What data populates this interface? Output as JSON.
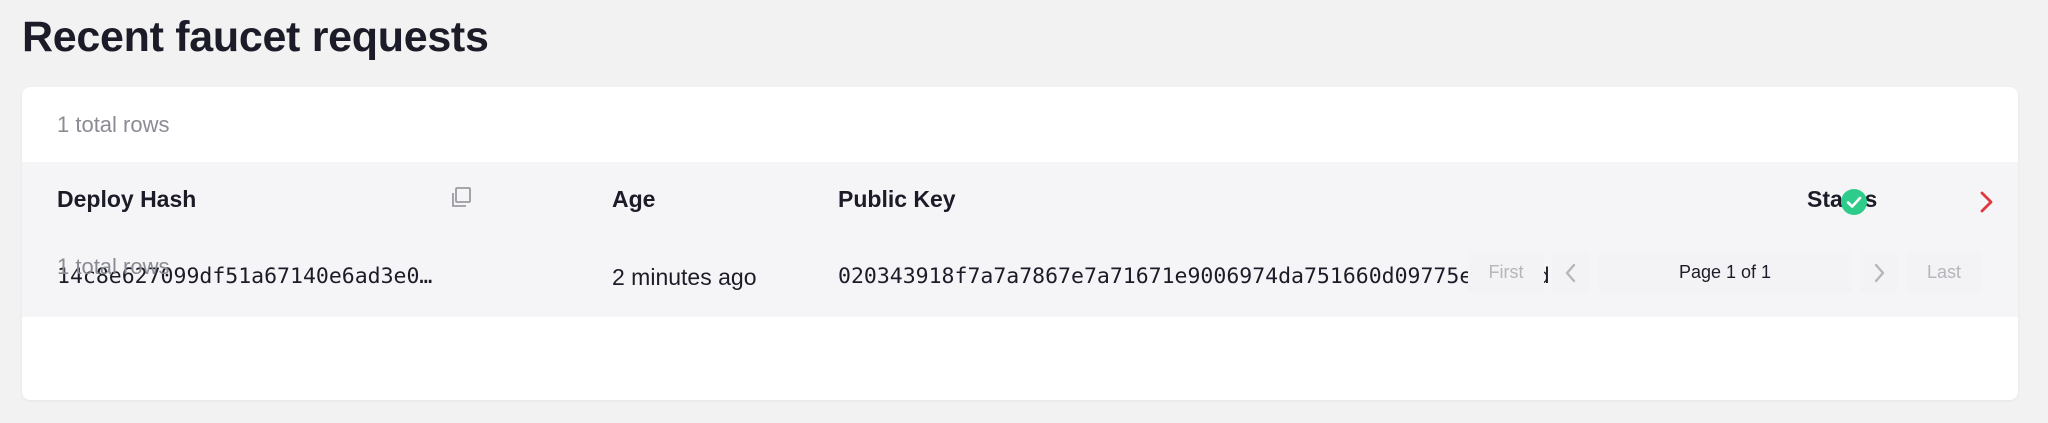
{
  "header": {
    "title": "Recent faucet requests"
  },
  "table": {
    "total_rows_top": "1 total rows",
    "total_rows_bottom": "1 total rows",
    "columns": {
      "deploy_hash": "Deploy Hash",
      "age": "Age",
      "public_key": "Public Key",
      "status": "Status"
    },
    "rows": [
      {
        "deploy_hash": "14c8e627099df51a67140e6ad3e0…",
        "age": "2 minutes ago",
        "public_key": "020343918f7a7a7867e7a71671e9006974da751660d09775e88d66d1…",
        "status": "success"
      }
    ]
  },
  "pagination": {
    "first": "First",
    "prev_icon": "chevron-left-icon",
    "page_label": "Page 1 of 1",
    "next_icon": "chevron-right-icon",
    "last": "Last"
  },
  "colors": {
    "success": "#2ecc8a",
    "accent_red": "#e0383e",
    "muted_text": "#8b8b94",
    "background": "#f2f2f3"
  }
}
